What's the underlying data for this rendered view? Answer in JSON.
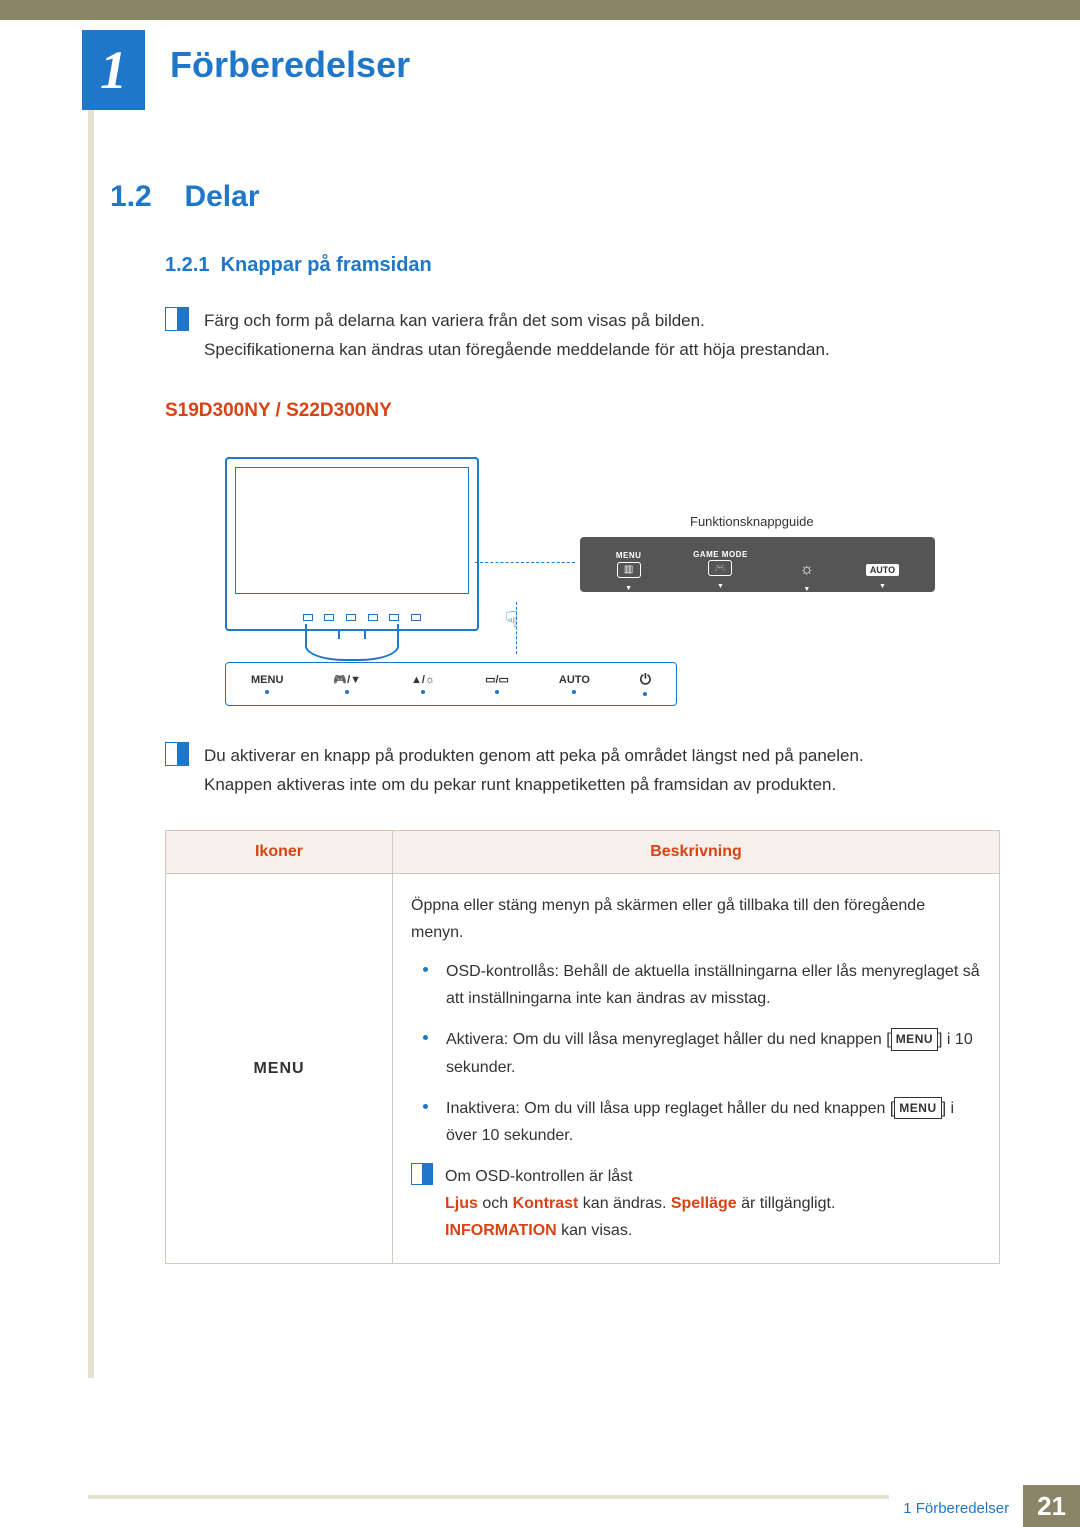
{
  "chapter": {
    "number": "1",
    "title": "Förberedelser"
  },
  "section": {
    "number": "1.2",
    "title": "Delar"
  },
  "subsection": {
    "number": "1.2.1",
    "title": "Knappar på framsidan"
  },
  "note1": {
    "line1": "Färg och form på delarna kan variera från det som visas på bilden.",
    "line2": "Specifikationerna kan ändras utan föregående meddelande för att höja prestandan."
  },
  "models": "S19D300NY / S22D300NY",
  "diagram": {
    "guide_label": "Funktionsknappguide",
    "guide_menu": "MENU",
    "guide_game": "GAME MODE",
    "guide_auto": "AUTO",
    "strip_menu": "MENU",
    "strip_auto": "AUTO"
  },
  "note2": {
    "line1": "Du aktiverar en knapp på produkten genom att peka på området längst ned på panelen.",
    "line2": "Knappen aktiveras inte om du pekar runt knappetiketten på framsidan av produkten."
  },
  "table": {
    "h_icons": "Ikoner",
    "h_desc": "Beskrivning",
    "row1": {
      "icon_label": "MENU",
      "intro": "Öppna eller stäng menyn på skärmen eller gå tillbaka till den föregående menyn.",
      "b1": "OSD-kontrollås: Behåll de aktuella inställningarna eller lås menyreglaget så att inställningarna inte kan ändras av misstag.",
      "b2a": "Aktivera: Om du vill låsa menyreglaget håller du ned knappen [",
      "b2b": "] i 10 sekunder.",
      "b3a": "Inaktivera: Om du vill låsa upp reglaget håller du ned knappen [",
      "b3b": "] i över 10 sekunder.",
      "note_title": "Om OSD-kontrollen är låst",
      "note_red1": "Ljus",
      "note_mid1": " och ",
      "note_red2": "Kontrast",
      "note_mid2": " kan ändras. ",
      "note_red3": "Spelläge",
      "note_mid3": " är tillgängligt. ",
      "note_red4": "INFORMATION",
      "note_end": " kan visas.",
      "menu_chip": "MENU"
    }
  },
  "footer": {
    "label": "1 Förberedelser",
    "page": "21"
  }
}
